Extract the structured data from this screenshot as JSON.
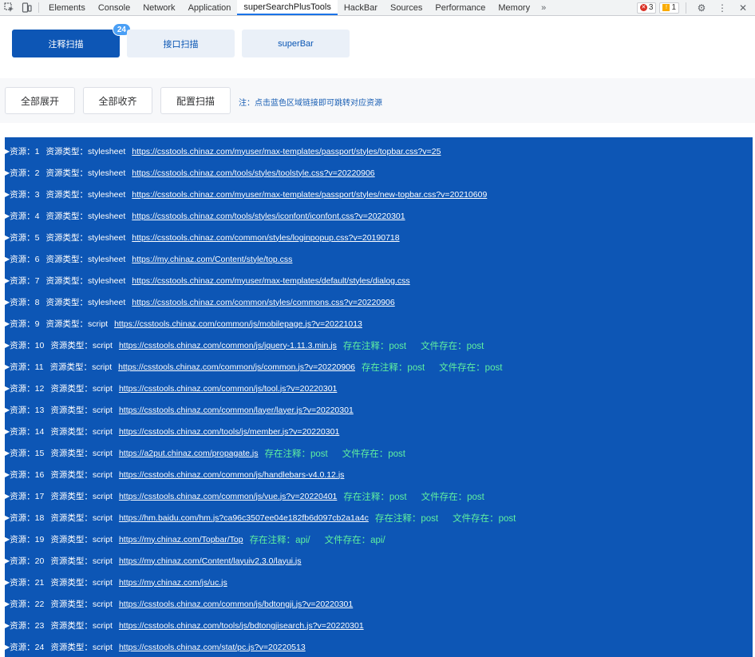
{
  "devtools": {
    "tabs": [
      "Elements",
      "Console",
      "Network",
      "Application",
      "superSearchPlusTools",
      "HackBar",
      "Sources",
      "Performance",
      "Memory"
    ],
    "active_tab": "superSearchPlusTools",
    "more": "»",
    "errors": "3",
    "warnings": "1"
  },
  "tool_tabs": {
    "injection": "注释扫描",
    "injection_count": "24",
    "api": "接口扫描",
    "superbar": "superBar"
  },
  "actions": {
    "expand_all": "全部展开",
    "collapse_all": "全部收齐",
    "config_scan": "配置扫描",
    "note": "注：点击蓝色区域链接即可跳转对应资源"
  },
  "labels": {
    "resource": "资源：",
    "type": "资源类型：",
    "comment": "存在注释：",
    "file": "文件存在："
  },
  "resources": [
    {
      "n": "1",
      "type": "stylesheet",
      "url": "https://csstools.chinaz.com/myuser/max-templates/passport/styles/topbar.css?v=25",
      "comment": "",
      "file": ""
    },
    {
      "n": "2",
      "type": "stylesheet",
      "url": "https://csstools.chinaz.com/tools/styles/toolstyle.css?v=20220906",
      "comment": "",
      "file": ""
    },
    {
      "n": "3",
      "type": "stylesheet",
      "url": "https://csstools.chinaz.com/myuser/max-templates/passport/styles/new-topbar.css?v=20210609",
      "comment": "",
      "file": ""
    },
    {
      "n": "4",
      "type": "stylesheet",
      "url": "https://csstools.chinaz.com/tools/styles/iconfont/iconfont.css?v=20220301",
      "comment": "",
      "file": ""
    },
    {
      "n": "5",
      "type": "stylesheet",
      "url": "https://csstools.chinaz.com/common/styles/loginpopup.css?v=20190718",
      "comment": "",
      "file": ""
    },
    {
      "n": "6",
      "type": "stylesheet",
      "url": "https://my.chinaz.com/Content/style/top.css",
      "comment": "",
      "file": ""
    },
    {
      "n": "7",
      "type": "stylesheet",
      "url": "https://csstools.chinaz.com/myuser/max-templates/default/styles/dialog.css",
      "comment": "",
      "file": ""
    },
    {
      "n": "8",
      "type": "stylesheet",
      "url": "https://csstools.chinaz.com/common/styles/commons.css?v=20220906",
      "comment": "",
      "file": ""
    },
    {
      "n": "9",
      "type": "script",
      "url": "https://csstools.chinaz.com/common/js/mobilepage.js?v=20221013",
      "comment": "",
      "file": ""
    },
    {
      "n": "10",
      "type": "script",
      "url": "https://csstools.chinaz.com/common/js/jquery-1.11.3.min.js",
      "comment": "post",
      "file": "post"
    },
    {
      "n": "11",
      "type": "script",
      "url": "https://csstools.chinaz.com/common/js/common.js?v=20220906",
      "comment": "post",
      "file": "post"
    },
    {
      "n": "12",
      "type": "script",
      "url": "https://csstools.chinaz.com/common/js/tool.js?v=20220301",
      "comment": "",
      "file": ""
    },
    {
      "n": "13",
      "type": "script",
      "url": "https://csstools.chinaz.com/common/layer/layer.js?v=20220301",
      "comment": "",
      "file": ""
    },
    {
      "n": "14",
      "type": "script",
      "url": "https://csstools.chinaz.com/tools/js/member.js?v=20220301",
      "comment": "",
      "file": ""
    },
    {
      "n": "15",
      "type": "script",
      "url": "https://a2put.chinaz.com/propagate.js",
      "comment": "post",
      "file": "post"
    },
    {
      "n": "16",
      "type": "script",
      "url": "https://csstools.chinaz.com/common/js/handlebars-v4.0.12.js",
      "comment": "",
      "file": ""
    },
    {
      "n": "17",
      "type": "script",
      "url": "https://csstools.chinaz.com/common/js/vue.js?v=20220401",
      "comment": "post",
      "file": "post"
    },
    {
      "n": "18",
      "type": "script",
      "url": "https://hm.baidu.com/hm.js?ca96c3507ee04e182fb6d097cb2a1a4c",
      "comment": "post",
      "file": "post"
    },
    {
      "n": "19",
      "type": "script",
      "url": "https://my.chinaz.com/Topbar/Top",
      "comment": "api/",
      "file": "api/"
    },
    {
      "n": "20",
      "type": "script",
      "url": "https://my.chinaz.com/Content/layuiv2.3.0/layui.js",
      "comment": "",
      "file": ""
    },
    {
      "n": "21",
      "type": "script",
      "url": "https://my.chinaz.com/js/uc.js",
      "comment": "",
      "file": ""
    },
    {
      "n": "22",
      "type": "script",
      "url": "https://csstools.chinaz.com/common/js/bdtongji.js?v=20220301",
      "comment": "",
      "file": ""
    },
    {
      "n": "23",
      "type": "script",
      "url": "https://csstools.chinaz.com/tools/js/bdtongjisearch.js?v=20220301",
      "comment": "",
      "file": ""
    },
    {
      "n": "24",
      "type": "script",
      "url": "https://csstools.chinaz.com/stat/pc.js?v=20220513",
      "comment": "",
      "file": ""
    }
  ]
}
